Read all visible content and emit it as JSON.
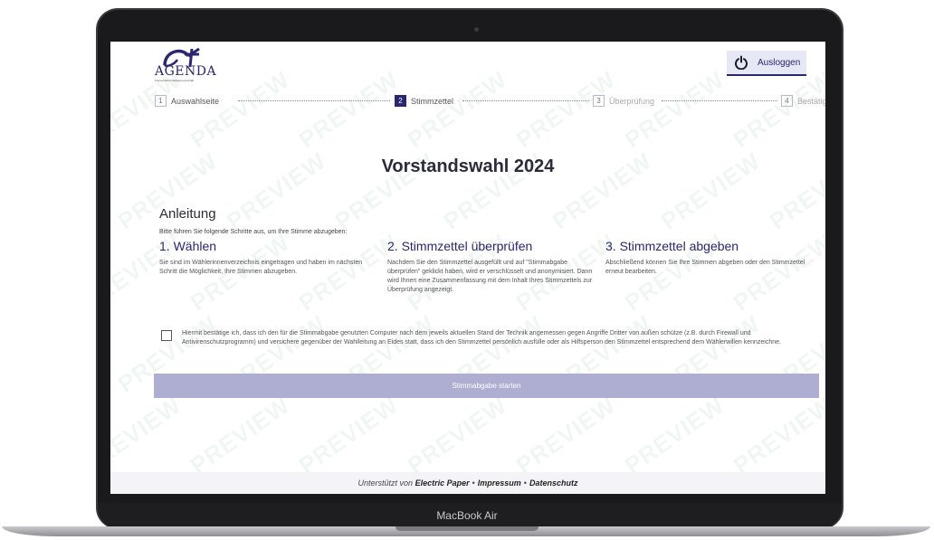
{
  "device": {
    "model_label": "MacBook Air"
  },
  "watermark": "PREVIEW",
  "header": {
    "logo_text": "AGENDA",
    "logo_sub": "Kreisverband Wahlgemeinschaft",
    "logout_label": "Ausloggen"
  },
  "stepper": {
    "steps": [
      {
        "num": "1",
        "label": "Auswahlseite"
      },
      {
        "num": "2",
        "label": "Stimmzettel"
      },
      {
        "num": "3",
        "label": "Überprüfung"
      },
      {
        "num": "4",
        "label": "Bestätigung"
      }
    ]
  },
  "main": {
    "title": "Vorstandswahl 2024",
    "section_heading": "Anleitung",
    "intro": "Bitte führen Sie folgende Schritte aus, um Ihre Stimme abzugeben:",
    "columns": [
      {
        "heading": "1. Wählen",
        "text": "Sie sind im Wählerinnenverzeichnis eingetragen und haben im nächsten Schritt die Möglichkeit, Ihre Stimmen abzugeben."
      },
      {
        "heading": "2. Stimmzettel überprüfen",
        "text": "Nachdem Sie den Stimmzettel ausgefüllt und auf \"Stimmabgabe überprüfen\" geklickt haben, wird er verschlüsselt und anonymisiert. Dann wird Ihnen eine Zusammenfassung mit dem Inhalt Ihres Stimmzettels zur Überprüfung angezeigt."
      },
      {
        "heading": "3. Stimmzettel abgeben",
        "text": "Abschließend können Sie Ihre Stimmen abgeben oder den Stimmzettel erneut bearbeiten."
      }
    ],
    "confirmation_text": "Hiermit bestätige ich, dass ich den für die Stimmabgabe genutzten Computer nach dem jeweils aktuellen Stand der Technik angemessen gegen Angriffe Dritter von außen schütze (z.B. durch Firewall und Antivirenschutzprogramm) und versichere gegenüber der Wahlleitung an Eides statt, dass ich den Stimmzettel persönlich ausfülle oder als Hilfsperson den Stimmzettel entsprechend dem Wählerwillen kennzeichne.",
    "start_button": "Stimmabgabe starten"
  },
  "footer": {
    "prefix": "Unterstützt von ",
    "brand": "Electric Paper",
    "separator": "•",
    "impressum": "Impressum",
    "datenschutz": "Datenschutz"
  },
  "colors": {
    "brand": "#2a2670",
    "button_disabled": "#aeaed2",
    "active_step": "#2a2670"
  }
}
